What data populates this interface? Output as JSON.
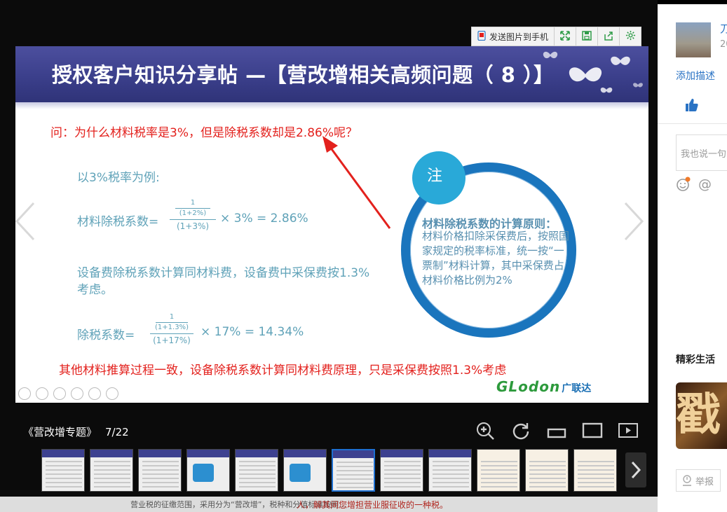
{
  "toolbar": {
    "send_to_phone_label": "发送图片到手机",
    "icons": [
      "phone-icon",
      "fullscreen-icon",
      "save-icon",
      "share-icon",
      "settings-icon"
    ]
  },
  "slide": {
    "title": "授权客户知识分享帖 —【营改增相关高频问题（ 8 ）】",
    "question": "问：为什么材料税率是3%，但是除税系数却是2.86%呢？",
    "example_heading": "以3%税率为例:",
    "formula1": {
      "label": "材料除税系数=",
      "num_top": "1",
      "num_bottom": "(1+2%)",
      "den": "(1+3%)",
      "tail": "× 3% = 2.86%"
    },
    "equipment_note": "设备费除税系数计算同材料费，设备费中采保费按1.3%考虑。",
    "formula2": {
      "label": "除税系数=",
      "num_top": "1",
      "num_bottom": "(1+1.3%)",
      "den": "(1+17%)",
      "tail": "× 17% = 14.34%"
    },
    "bottom_note": "其他材料推算过程一致，设备除税系数计算同材料费原理，只是采保费按照1.3%考虑",
    "note_badge": "注",
    "ring_title": "材料除税系数的计算原则：",
    "ring_body": "材料价格扣除采保费后，按照国家规定的税率标准，统一按“一票制”材料计算，其中采保费占材料价格比例为2%",
    "logo_en": "GLodon",
    "logo_cn": "广联达",
    "colors": {
      "accent_red": "#e3211d",
      "teal_text": "#5fa2b8",
      "ring_blue": "#1a75bd",
      "badge_blue": "#29a9d8"
    }
  },
  "album": {
    "name": "《营改增专题》",
    "pages": "7/22"
  },
  "view_controls": [
    "zoom-in-icon",
    "rotate-icon",
    "fit-icon",
    "original-size-icon",
    "slideshow-icon"
  ],
  "thumbnails": {
    "count": 13,
    "active_index": 6
  },
  "peek": {
    "left_text": "营业税的征缴范围，采用分为“营改增”，税种和分值标准按照...",
    "red_text": "人，解其间您增担营业服征收的一种税。"
  },
  "sidebar": {
    "user_name": "刀",
    "user_date": "20",
    "add_description": "添加描述",
    "comment_placeholder": "我也说一句",
    "at_symbol": "@",
    "section_title": "精彩生活",
    "promo_char": "戳",
    "report_label": "举报"
  }
}
